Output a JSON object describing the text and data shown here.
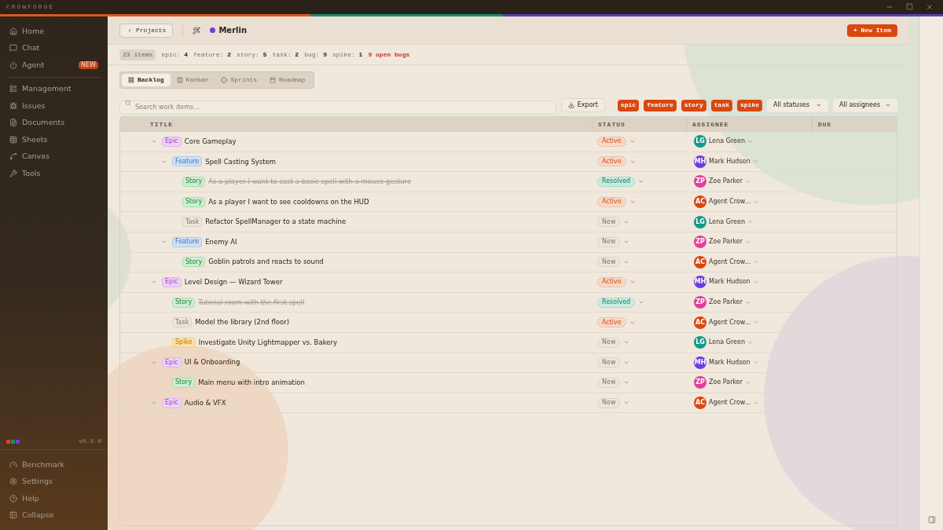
{
  "app": {
    "title": "CROWFORGE",
    "version": "v0.5.0"
  },
  "sidebar": {
    "items": [
      {
        "label": "Home"
      },
      {
        "label": "Chat"
      },
      {
        "label": "Agent",
        "badge": "NEW"
      },
      {
        "label": "Management"
      },
      {
        "label": "Issues"
      },
      {
        "label": "Documents"
      },
      {
        "label": "Sheets"
      },
      {
        "label": "Canvas"
      },
      {
        "label": "Tools"
      }
    ],
    "bottom_items": [
      {
        "label": "Benchmark"
      },
      {
        "label": "Settings"
      },
      {
        "label": "Help"
      },
      {
        "label": "Collapse"
      }
    ]
  },
  "header": {
    "back": "Projects",
    "project": "Merlin",
    "new_item": "+ New Item"
  },
  "stats": {
    "total": "23 items",
    "counts": [
      {
        "label": "epic:",
        "value": "4"
      },
      {
        "label": "feature:",
        "value": "2"
      },
      {
        "label": "story:",
        "value": "5"
      },
      {
        "label": "task:",
        "value": "2"
      },
      {
        "label": "bug:",
        "value": "9"
      },
      {
        "label": "spike:",
        "value": "1"
      }
    ],
    "alert": "9 open bugs"
  },
  "tabs": [
    {
      "label": "Backlog",
      "selected": true
    },
    {
      "label": "Kanban",
      "selected": false
    },
    {
      "label": "Sprints",
      "selected": false
    },
    {
      "label": "Roadmap",
      "selected": false
    }
  ],
  "toolbar": {
    "search": {
      "placeholder": "Search work items..."
    },
    "export": "Export",
    "type_filters": [
      {
        "label": "epic",
        "selected": true
      },
      {
        "label": "feature",
        "selected": true
      },
      {
        "label": "story",
        "selected": true
      },
      {
        "label": "task",
        "selected": true
      },
      {
        "label": "spike",
        "selected": true
      }
    ],
    "status_filter": "All statuses",
    "assignee_filter": "All assignees"
  },
  "table": {
    "columns": [
      "TITLE",
      "STATUS",
      "ASSIGNEE",
      "DUE"
    ],
    "rows": [
      {
        "kind": "epic",
        "type": "Epic",
        "title": "Core Gameplay",
        "done": false,
        "expanded": true,
        "status": {
          "kind": "active",
          "label": "Active"
        },
        "assignee": {
          "initials": "LG",
          "name": "Lena Green",
          "color": "#13998a"
        },
        "children": [
          {
            "kind": "feature",
            "type": "Feature",
            "title": "Spell Casting System",
            "done": false,
            "expanded": true,
            "status": {
              "kind": "active",
              "label": "Active"
            },
            "assignee": {
              "initials": "MH",
              "name": "Mark Hudson",
              "color": "#6d3fe0"
            },
            "children": [
              {
                "kind": "story",
                "type": "Story",
                "title": "As a player I want to cast a basic spell with a mouse gesture",
                "done": true,
                "status": {
                  "kind": "resolved",
                  "label": "Resolved"
                },
                "assignee": {
                  "initials": "ZP",
                  "name": "Zoe Parker",
                  "color": "#e0409a"
                }
              },
              {
                "kind": "story",
                "type": "Story",
                "title": "As a player I want to see cooldowns on the HUD",
                "done": false,
                "status": {
                  "kind": "active",
                  "label": "Active"
                },
                "assignee": {
                  "initials": "AC",
                  "name": "Agent Crow...",
                  "color": "#d9480f"
                }
              },
              {
                "kind": "task",
                "type": "Task",
                "title": "Refactor SpellManager to a state machine",
                "done": false,
                "status": {
                  "kind": "new",
                  "label": "New"
                },
                "assignee": {
                  "initials": "LG",
                  "name": "Lena Green",
                  "color": "#13998a"
                }
              }
            ]
          },
          {
            "kind": "feature",
            "type": "Feature",
            "title": "Enemy AI",
            "done": false,
            "expanded": true,
            "status": {
              "kind": "new",
              "label": "New"
            },
            "assignee": {
              "initials": "ZP",
              "name": "Zoe Parker",
              "color": "#e0409a"
            },
            "children": [
              {
                "kind": "story",
                "type": "Story",
                "title": "Goblin patrols and reacts to sound",
                "done": false,
                "status": {
                  "kind": "new",
                  "label": "New"
                },
                "assignee": {
                  "initials": "AC",
                  "name": "Agent Crow...",
                  "color": "#d9480f"
                }
              }
            ]
          }
        ]
      },
      {
        "kind": "epic",
        "type": "Epic",
        "title": "Level Design — Wizard Tower",
        "done": false,
        "expanded": true,
        "status": {
          "kind": "active",
          "label": "Active"
        },
        "assignee": {
          "initials": "MH",
          "name": "Mark Hudson",
          "color": "#6d3fe0"
        },
        "children": [
          {
            "kind": "story",
            "type": "Story",
            "title": "Tutorial room with the first spell",
            "done": true,
            "status": {
              "kind": "resolved",
              "label": "Resolved"
            },
            "assignee": {
              "initials": "ZP",
              "name": "Zoe Parker",
              "color": "#e0409a"
            }
          },
          {
            "kind": "task",
            "type": "Task",
            "title": "Model the library (2nd floor)",
            "done": false,
            "status": {
              "kind": "active",
              "label": "Active"
            },
            "assignee": {
              "initials": "AC",
              "name": "Agent Crow...",
              "color": "#d9480f"
            }
          },
          {
            "kind": "spike",
            "type": "Spike",
            "title": "Investigate Unity Lightmapper vs. Bakery",
            "done": false,
            "status": {
              "kind": "new",
              "label": "New"
            },
            "assignee": {
              "initials": "LG",
              "name": "Lena Green",
              "color": "#13998a"
            }
          }
        ]
      },
      {
        "kind": "epic",
        "type": "Epic",
        "title": "UI & Onboarding",
        "done": false,
        "expanded": true,
        "status": {
          "kind": "new",
          "label": "New"
        },
        "assignee": {
          "initials": "MH",
          "name": "Mark Hudson",
          "color": "#6d3fe0"
        },
        "children": [
          {
            "kind": "story",
            "type": "Story",
            "title": "Main menu with intro animation",
            "done": false,
            "status": {
              "kind": "new",
              "label": "New"
            },
            "assignee": {
              "initials": "ZP",
              "name": "Zoe Parker",
              "color": "#e0409a"
            }
          }
        ]
      },
      {
        "kind": "epic",
        "type": "Epic",
        "title": "Audio & VFX",
        "done": false,
        "expanded": true,
        "status": {
          "kind": "new",
          "label": "New"
        },
        "assignee": {
          "initials": "AC",
          "name": "Agent Crow...",
          "color": "#d9480f"
        }
      }
    ]
  }
}
